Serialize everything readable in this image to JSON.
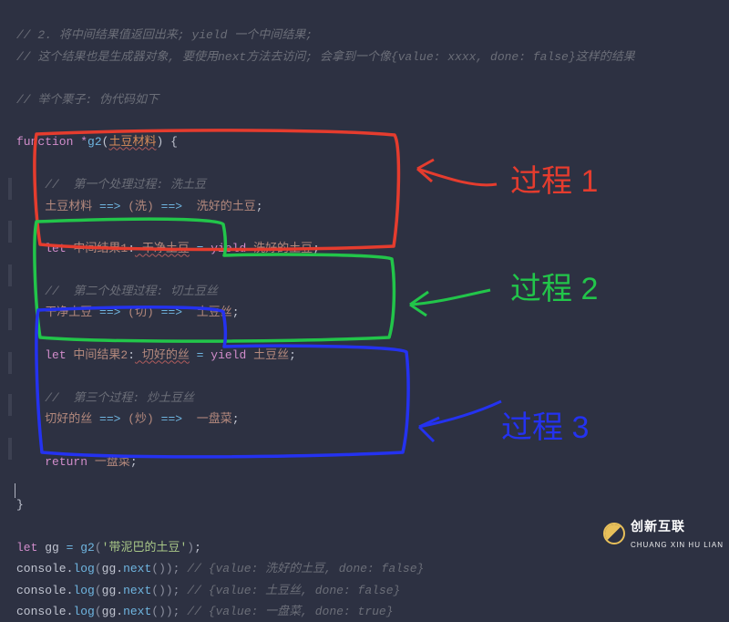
{
  "code": {
    "c1": "// 2. 将中间结果值返回出来; yield 一个中间结果;",
    "c2": "// 这个结果也是生成器对象, 要使用next方法去访问; 会拿到一个像{value: xxxx, done: false}这样的结果",
    "c3": "// 举个栗子: 伪代码如下",
    "fn_kw": "function",
    "star": "*",
    "fn_name": "g2",
    "fn_open": "(",
    "fn_param": "土豆材料",
    "fn_close": ") {",
    "s1_c": "//  第一个处理过程: 洗土豆",
    "s1_a": "土豆材料",
    "s1_op1": " ==>",
    "s1_p1": " (洗) ",
    "s1_op2": "==> ",
    "s1_b": " 洗好的土豆",
    "semi": ";",
    "let": "let",
    "r1_name": " 中间结果1",
    "colon": ":",
    "r1_type": " 干净土豆",
    "eq": " = ",
    "yield": "yield",
    "r1_val": " 洗好的土豆",
    "s2_c": "//  第二个处理过程: 切土豆丝",
    "s2_a": "干净土豆",
    "s2_p1": " (切) ",
    "s2_b": " 土豆丝",
    "r2_name": " 中间结果2",
    "r2_type": " 切好的丝",
    "r2_val": " 土豆丝",
    "s3_c": "//  第三个过程: 炒土豆丝",
    "s3_a": "切好的丝",
    "s3_p1": " (炒) ",
    "s3_b": " 一盘菜",
    "return": "return",
    "ret_val": " 一盘菜",
    "close_brace": "}",
    "gg_name": "gg",
    "gg_eq": " = ",
    "gg_call_arg": "'带泥巴的土豆'",
    "console": "console",
    "dot": ".",
    "log": "log",
    "next": "next",
    "l1_c": " // {value: 洗好的土豆, done: false}",
    "l2_c": " // {value: 土豆丝, done: false}",
    "l3_c": " // {value: 一盘菜, done: true}"
  },
  "annotations": {
    "a1": "过程 1",
    "a2": "过程 2",
    "a3": "过程 3"
  },
  "logo": {
    "title": "创新互联",
    "sub": "CHUANG XIN HU LIAN"
  },
  "colors": {
    "bg": "#2d3142",
    "red": "#e53c2e",
    "green": "#22c54a",
    "blue": "#2432f0"
  }
}
